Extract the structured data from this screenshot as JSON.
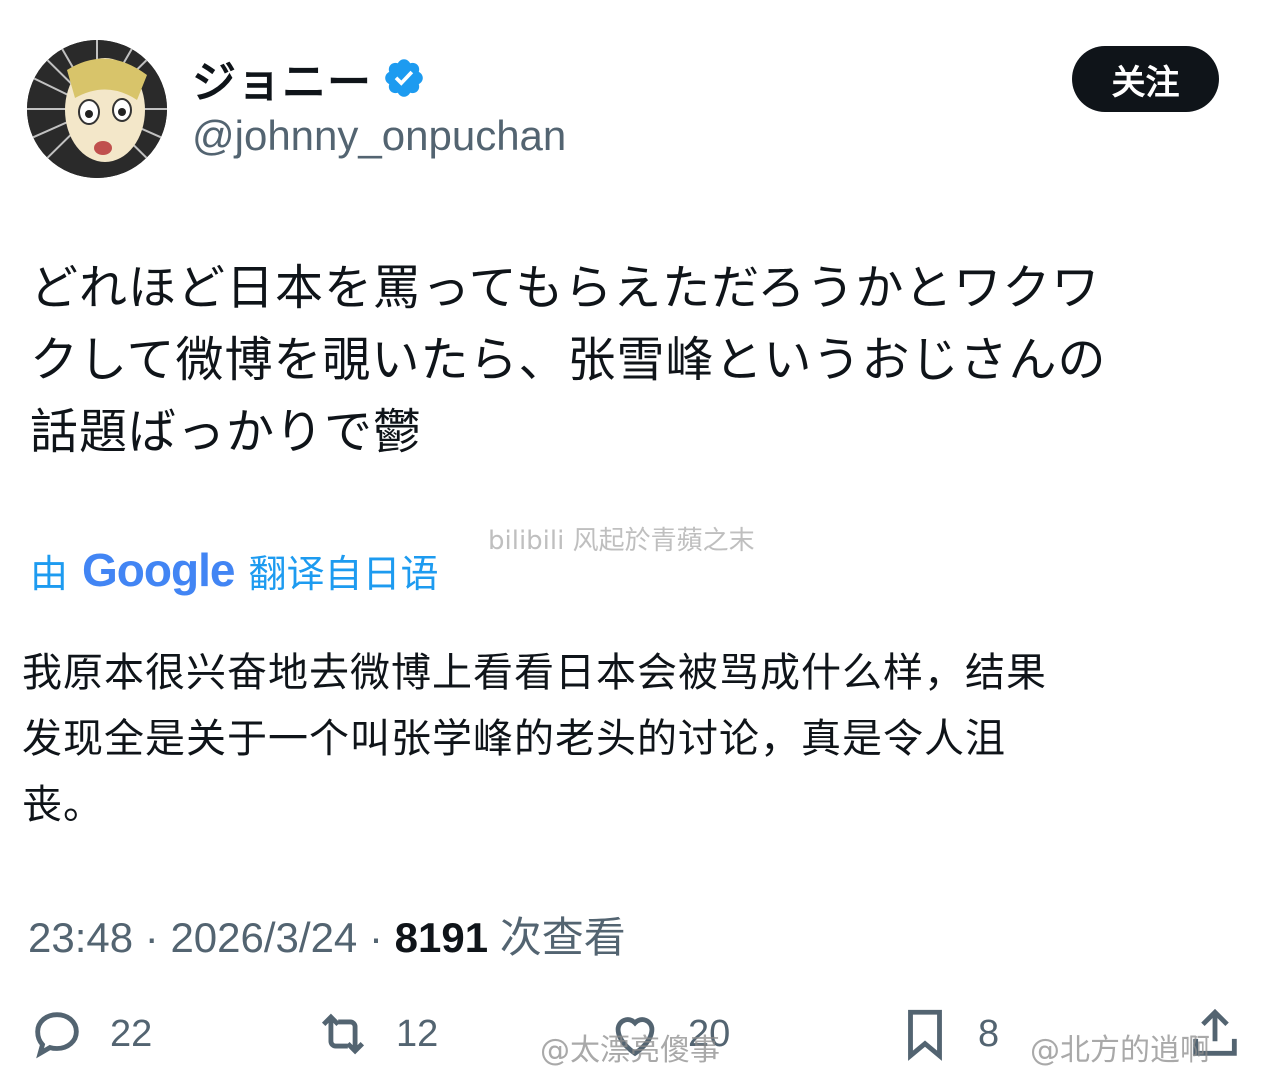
{
  "user": {
    "display_name": "ジョニー",
    "handle": "@johnny_onpuchan",
    "verified": true
  },
  "follow_label": "关注",
  "tweet": {
    "text_lines": [
      "どれほど日本を罵ってもらえただろうかとワクワ",
      "クして微博を覗いたら、张雪峰というおじさんの",
      "話題ばっかりで鬱"
    ]
  },
  "translation": {
    "prefix": "由",
    "google": "Google",
    "suffix": "翻译自日语",
    "text_lines": [
      "我原本很兴奋地去微博上看看日本会被骂成什么样，结果",
      "发现全是关于一个叫张学峰的老头的讨论，真是令人沮",
      "丧。"
    ]
  },
  "meta": {
    "time": "23:48",
    "date": "2026/3/24",
    "views_count": "8191",
    "views_label": "次查看"
  },
  "actions": {
    "replies": "22",
    "reposts": "12",
    "likes": "20",
    "bookmarks": "8"
  },
  "watermarks": {
    "bilibili": "bilibili 风起於青蘋之末",
    "weibo_1": "@太漂亮傻事",
    "weibo_2": "@北方的逍啊"
  },
  "colors": {
    "accent": "#1d9bf0",
    "text": "#0f1419",
    "secondary": "#536471",
    "button_bg": "#0f1419"
  }
}
